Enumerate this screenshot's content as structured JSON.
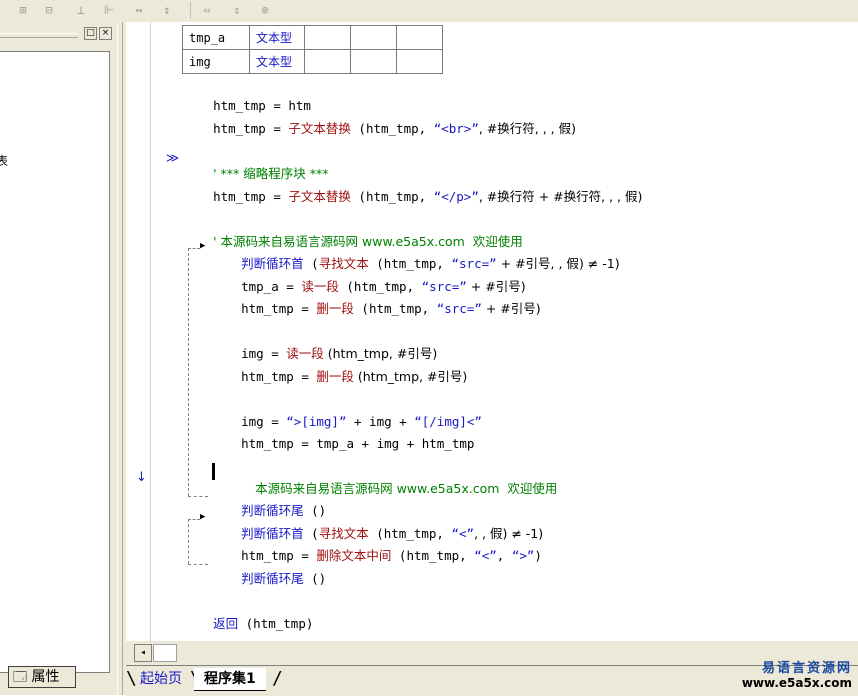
{
  "toolbar": {
    "buttons": [
      "align-left-icon",
      "align-top-icon",
      "align-bottom-icon",
      "align-middle-icon",
      "width-equal-icon",
      "height-equal-icon",
      "width-fit-icon",
      "height-fit-icon",
      "center-icon"
    ]
  },
  "left_panel": {
    "minimize_glyph": "□",
    "close_glyph": "×",
    "partial_text": "表",
    "tab_label": "属性",
    "tab_icon": "properties-icon"
  },
  "var_table": {
    "rows": [
      {
        "name": "tmp_a",
        "type": "文本型"
      },
      {
        "name": "img",
        "type": "文本型"
      }
    ]
  },
  "code": {
    "l1_a": "htm_tmp = htm",
    "l2_a": "htm_tmp = ",
    "l2_cmd": "子文本替换",
    "l2_b": " (htm_tmp, ",
    "l2_str": "“<br>”",
    "l2_c": ", #换行符, , , 假)",
    "l3_mark": "≫",
    "l3_cmt": "' *** 缩略程序块 ***",
    "l4_a": "htm_tmp = ",
    "l4_cmd": "子文本替换",
    "l4_b": " (htm_tmp, ",
    "l4_str": "“</p>”",
    "l4_c": ", #换行符 + #换行符, , , 假)",
    "l5_cmt": "' 本源码来自易语言源码网 www.e5a5x.com  欢迎使用",
    "l6_kw": "判断循环首",
    "l6_a": " (",
    "l6_cmd": "寻找文本",
    "l6_b": " (htm_tmp, ",
    "l6_str": "“src=”",
    "l6_c": " + #引号, , 假) ≠ -1)",
    "l7_a": "tmp_a = ",
    "l7_cmd": "读一段",
    "l7_b": " (htm_tmp, ",
    "l7_str": "“src=”",
    "l7_c": " + #引号)",
    "l8_a": "htm_tmp = ",
    "l8_cmd": "删一段",
    "l8_b": " (htm_tmp, ",
    "l8_str": "“src=”",
    "l8_c": " + #引号)",
    "l9_a": "img = ",
    "l9_cmd": "读一段",
    "l9_b": " (htm_tmp, #引号)",
    "l10_a": "htm_tmp = ",
    "l10_cmd": "删一段",
    "l10_b": " (htm_tmp, #引号)",
    "l11_a": "img = ",
    "l11_str1": "“>[img]”",
    "l11_b": " + img + ",
    "l11_str2": "“[/img]<”",
    "l12_a": "htm_tmp = tmp_a + img + htm_tmp",
    "l13_cmt": "本源码来自易语言源码网 www.e5a5x.com  欢迎使用",
    "l13_mark": "↓",
    "l14_kw": "判断循环尾",
    "l14_a": " ()",
    "l15_kw": "判断循环首",
    "l15_a": " (",
    "l15_cmd": "寻找文本",
    "l15_b": " (htm_tmp, ",
    "l15_str": "“<”",
    "l15_c": ", , 假) ≠ -1)",
    "l16_a": "htm_tmp = ",
    "l16_cmd": "删除文本中间",
    "l16_b": " (htm_tmp, ",
    "l16_str1": "“<”",
    "l16_c": ", ",
    "l16_str2": "“>”",
    "l16_d": ")",
    "l17_kw": "判断循环尾",
    "l17_a": " ()",
    "l18_kw": "返回",
    "l18_a": " (htm_tmp)"
  },
  "scroll": {
    "left_glyph": "◂"
  },
  "tabs": {
    "start": "起始页",
    "program": "程序集1"
  },
  "watermark": {
    "line1": "易语言资源网",
    "line2": "www.e5a5x.com"
  }
}
